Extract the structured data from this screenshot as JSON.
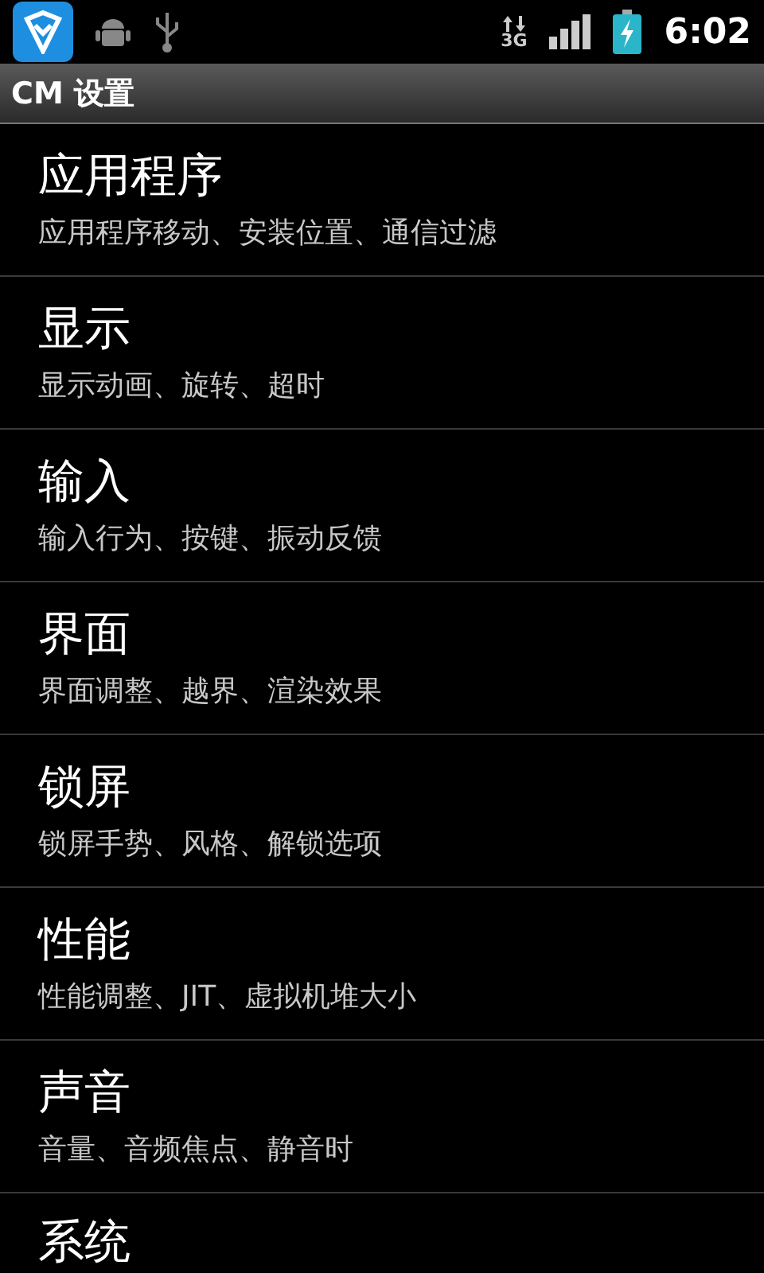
{
  "status_bar": {
    "time": "6:02",
    "network": "3G"
  },
  "title_bar": {
    "title": "CM 设置"
  },
  "items": [
    {
      "title": "应用程序",
      "summary": "应用程序移动、安装位置、通信过滤"
    },
    {
      "title": "显示",
      "summary": "显示动画、旋转、超时"
    },
    {
      "title": "输入",
      "summary": "输入行为、按键、振动反馈"
    },
    {
      "title": "界面",
      "summary": "界面调整、越界、渲染效果"
    },
    {
      "title": "锁屏",
      "summary": "锁屏手势、风格、解锁选项"
    },
    {
      "title": "性能",
      "summary": "性能调整、JIT、虚拟机堆大小"
    },
    {
      "title": "声音",
      "summary": "音量、音频焦点、静音时"
    },
    {
      "title": "系统"
    }
  ]
}
